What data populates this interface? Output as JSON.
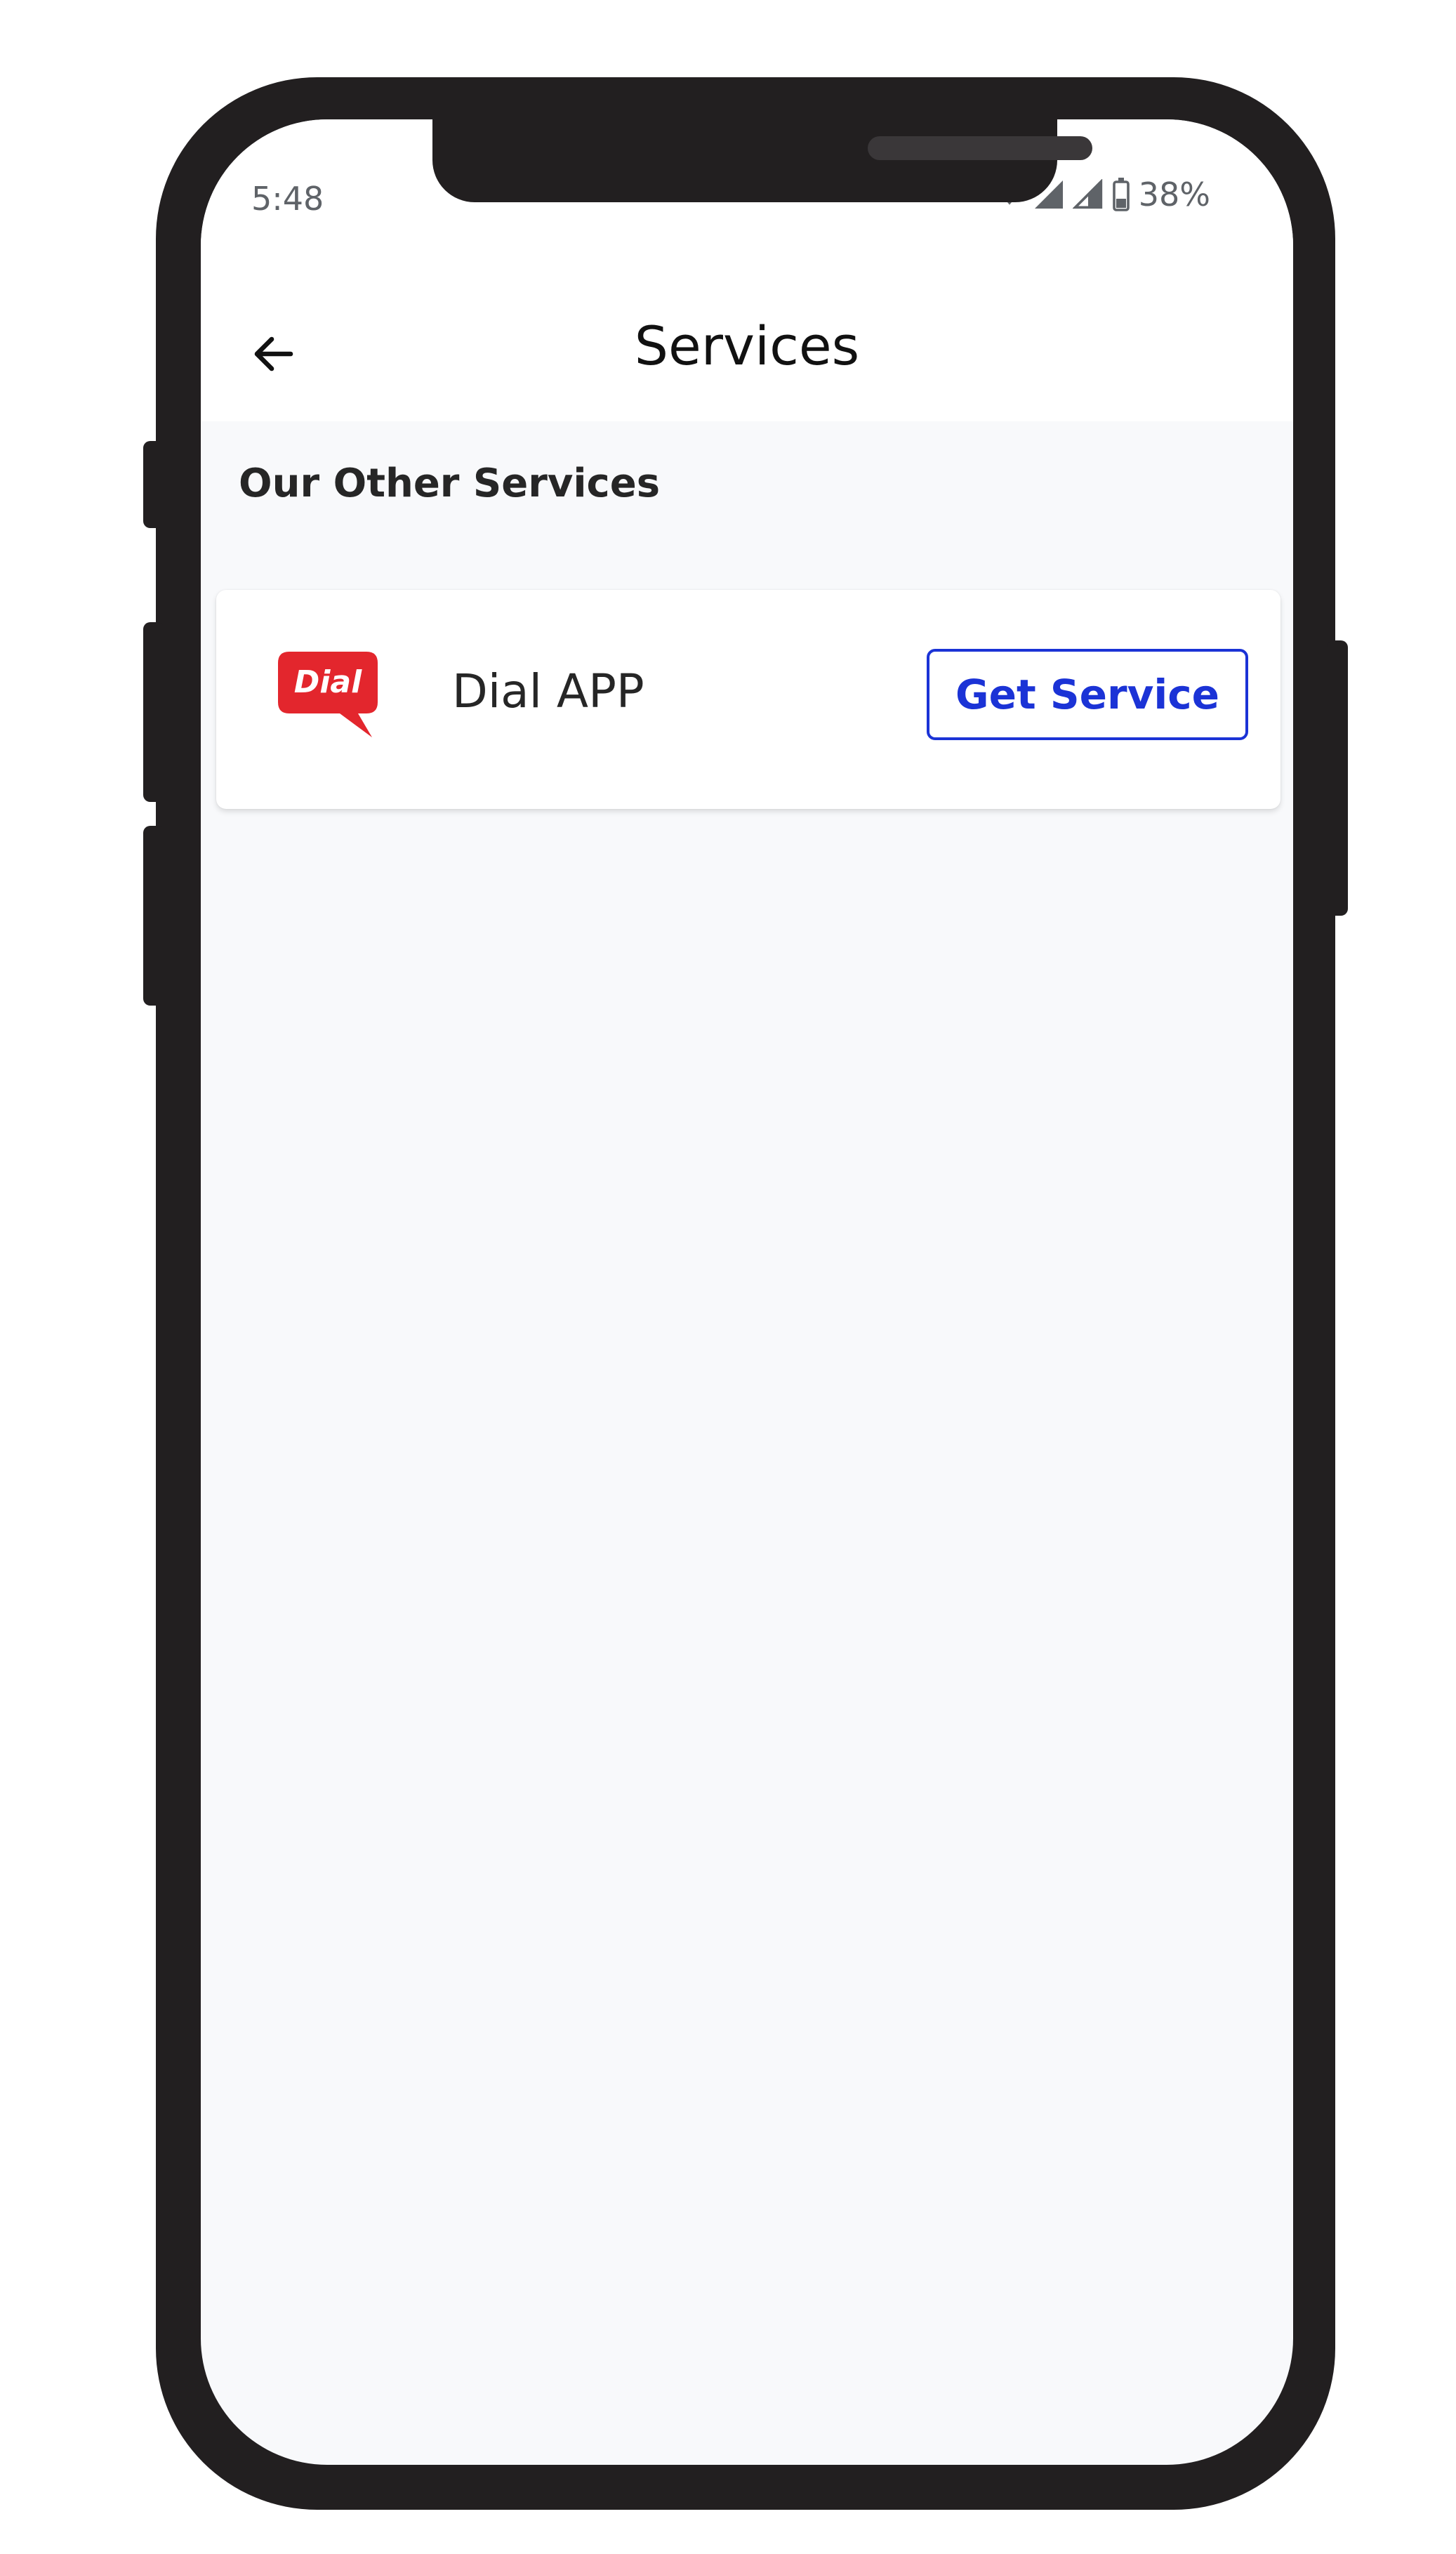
{
  "status_bar": {
    "time": "5:48",
    "battery": "38%",
    "icons": [
      "wifi-icon",
      "cell-signal-icon",
      "cell-signal-empty-icon",
      "battery-icon"
    ]
  },
  "app_bar": {
    "title": "Services",
    "back_icon": "arrow-left-icon"
  },
  "section": {
    "title": "Our Other Services"
  },
  "services": [
    {
      "logo_text": "Dial",
      "name": "Dial APP",
      "action_label": "Get Service"
    }
  ],
  "colors": {
    "accent": "#1b33d6",
    "logo_red": "#e3262d",
    "background": "#f8f9fb",
    "frame": "#221f20"
  }
}
